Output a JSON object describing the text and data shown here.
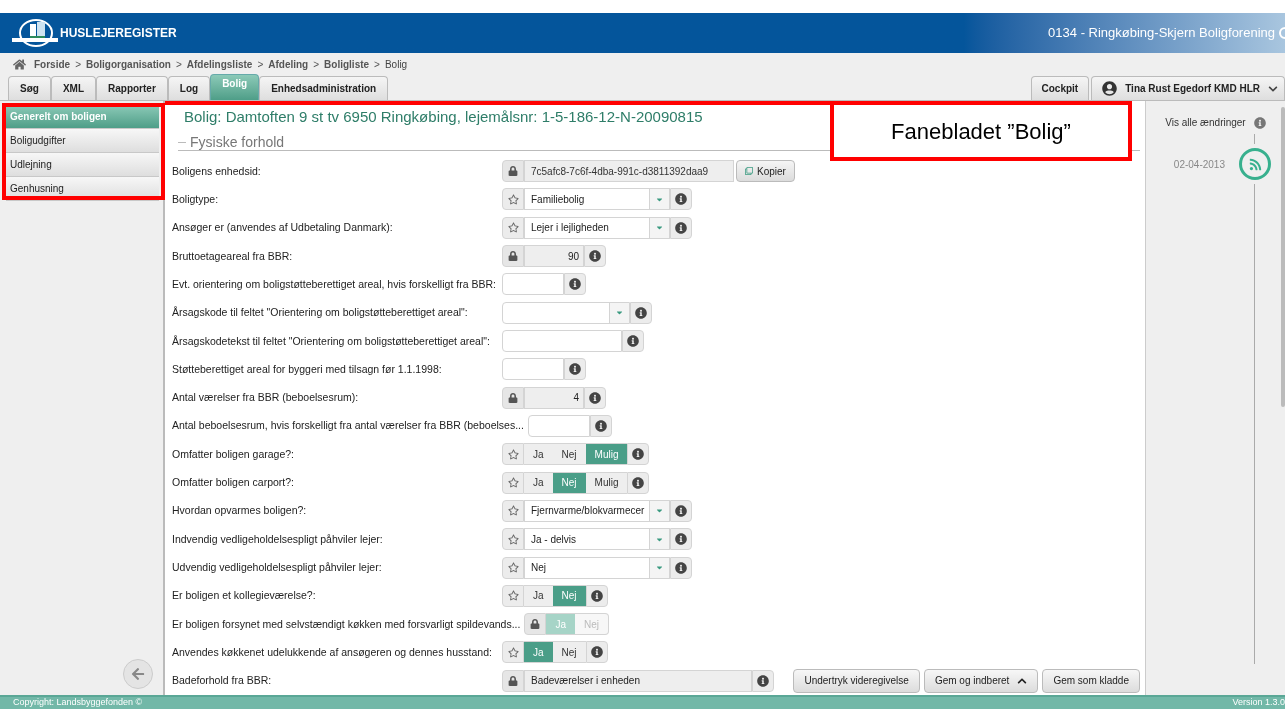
{
  "header": {
    "app_name": "HUSLEJEREGISTER",
    "organization": "0134 - Ringkøbing-Skjern Boligforening"
  },
  "breadcrumb": {
    "separator": ">",
    "items": [
      {
        "label": "Forside",
        "selected": false
      },
      {
        "label": "Boligorganisation",
        "selected": false
      },
      {
        "label": "Afdelingsliste",
        "selected": false
      },
      {
        "label": "Afdeling",
        "selected": false
      },
      {
        "label": "Boligliste",
        "selected": false
      },
      {
        "label": "Bolig",
        "selected": true
      }
    ]
  },
  "tabs": [
    {
      "label": "Søg",
      "selected": false
    },
    {
      "label": "XML",
      "selected": false
    },
    {
      "label": "Rapporter",
      "selected": false
    },
    {
      "label": "Log",
      "selected": false
    },
    {
      "label": "Bolig",
      "selected": true
    },
    {
      "label": "Enhedsadministration",
      "selected": false
    }
  ],
  "right_tabs": {
    "cockpit": "Cockpit",
    "user": "Tina Rust Egedorf KMD HLR"
  },
  "sidebar": {
    "items": [
      {
        "label": "Generelt om boligen",
        "selected": true
      },
      {
        "label": "Boligudgifter",
        "selected": false
      },
      {
        "label": "Udlejning",
        "selected": false
      },
      {
        "label": "Genhusning",
        "selected": false
      }
    ]
  },
  "page_title": "Bolig: Damtoften 9 st tv 6950 Ringkøbing, lejemålsnr: 1-5-186-12-N-20090815",
  "section_heading": "Fysiske forhold",
  "rows": [
    {
      "label": "Boligens enhedsid:",
      "kind": "id",
      "lock": true,
      "star": false,
      "value": "7c5afc8-7c6f-4dba-991c-d3811392daa9",
      "button": "Kopier",
      "info": false
    },
    {
      "label": "Boligtype:",
      "kind": "select",
      "lock": false,
      "star": true,
      "value": "Familiebolig",
      "info": true
    },
    {
      "label": "Ansøger er (anvendes af Udbetaling Danmark):",
      "kind": "select",
      "lock": false,
      "star": true,
      "value": "Lejer i lejligheden",
      "info": true
    },
    {
      "label": "Bruttoetageareal fra BBR:",
      "kind": "number",
      "lock": true,
      "star": false,
      "value": "90",
      "info": true
    },
    {
      "label": "Evt. orientering om boligstøtteberettiget areal, hvis forskelligt fra BBR:",
      "kind": "number",
      "lock": false,
      "star": false,
      "info": true
    },
    {
      "label": "Årsagskode til feltet \"Orientering om boligstøtteberettiget areal\":",
      "kind": "select",
      "lock": false,
      "star": false,
      "info": true
    },
    {
      "label": "Årsagskodetekst til feltet \"Orientering om boligstøtteberettiget areal\":",
      "kind": "text",
      "lock": false,
      "star": false,
      "info": true
    },
    {
      "label": "Støtteberettiget areal for byggeri med tilsagn før 1.1.1998:",
      "kind": "number",
      "lock": false,
      "star": false,
      "info": true
    },
    {
      "label": "Antal værelser fra BBR (beboelsesrum):",
      "kind": "number",
      "lock": true,
      "star": false,
      "value": "4",
      "info": true
    },
    {
      "label": "Antal beboelsesrum, hvis forskelligt fra antal værelser fra BBR (beboelses...",
      "kind": "number",
      "lock": false,
      "star": false,
      "info": true
    },
    {
      "label": "Omfatter boligen garage?:",
      "kind": "toggle",
      "lock": false,
      "star": true,
      "disabled": false,
      "info": true,
      "options": [
        {
          "label": "Ja",
          "selected": false
        },
        {
          "label": "Nej",
          "selected": false
        },
        {
          "label": "Mulig",
          "selected": true
        }
      ]
    },
    {
      "label": "Omfatter boligen carport?:",
      "kind": "toggle",
      "lock": false,
      "star": true,
      "disabled": false,
      "info": true,
      "options": [
        {
          "label": "Ja",
          "selected": false
        },
        {
          "label": "Nej",
          "selected": true
        },
        {
          "label": "Mulig",
          "selected": false
        }
      ]
    },
    {
      "label": "Hvordan opvarmes boligen?:",
      "kind": "select",
      "lock": false,
      "star": true,
      "value": "Fjernvarme/blokvarmecer",
      "info": true
    },
    {
      "label": "Indvendig vedligeholdelsespligt påhviler lejer:",
      "kind": "select",
      "lock": false,
      "star": true,
      "value": "Ja - delvis",
      "info": true
    },
    {
      "label": "Udvendig vedligeholdelsespligt påhviler lejer:",
      "kind": "select",
      "lock": false,
      "star": true,
      "value": "Nej",
      "info": true
    },
    {
      "label": "Er boligen et kollegieværelse?:",
      "kind": "toggle",
      "lock": false,
      "star": true,
      "disabled": false,
      "info": true,
      "options": [
        {
          "label": "Ja",
          "selected": false
        },
        {
          "label": "Nej",
          "selected": true
        }
      ]
    },
    {
      "label": "Er boligen forsynet med selvstændigt køkken med forsvarligt spildevands...",
      "kind": "toggle",
      "lock": true,
      "star": false,
      "disabled": true,
      "info": false,
      "options": [
        {
          "label": "Ja",
          "selected": true
        },
        {
          "label": "Nej",
          "selected": false
        }
      ]
    },
    {
      "label": "Anvendes køkkenet udelukkende af ansøgeren og dennes husstand:",
      "kind": "toggle",
      "lock": false,
      "star": true,
      "disabled": false,
      "info": true,
      "options": [
        {
          "label": "Ja",
          "selected": true
        },
        {
          "label": "Nej",
          "selected": false
        }
      ]
    },
    {
      "label": "Badeforhold fra BBR:",
      "kind": "wide",
      "lock": true,
      "star": false,
      "value": "Badeværelser i enheden",
      "info": true
    }
  ],
  "actions": [
    "Undertryk videregivelse",
    "Gem og indberet",
    "Gem som kladde"
  ],
  "history": {
    "title": "Vis alle ændringer",
    "entries": [
      {
        "date": "02-04-2013"
      }
    ]
  },
  "footer": {
    "copyright": "Copyright: Landsbyggefonden ©",
    "version": "Version 1.3.0"
  },
  "callout": {
    "text": "Fanebladet ”Bolig”"
  }
}
